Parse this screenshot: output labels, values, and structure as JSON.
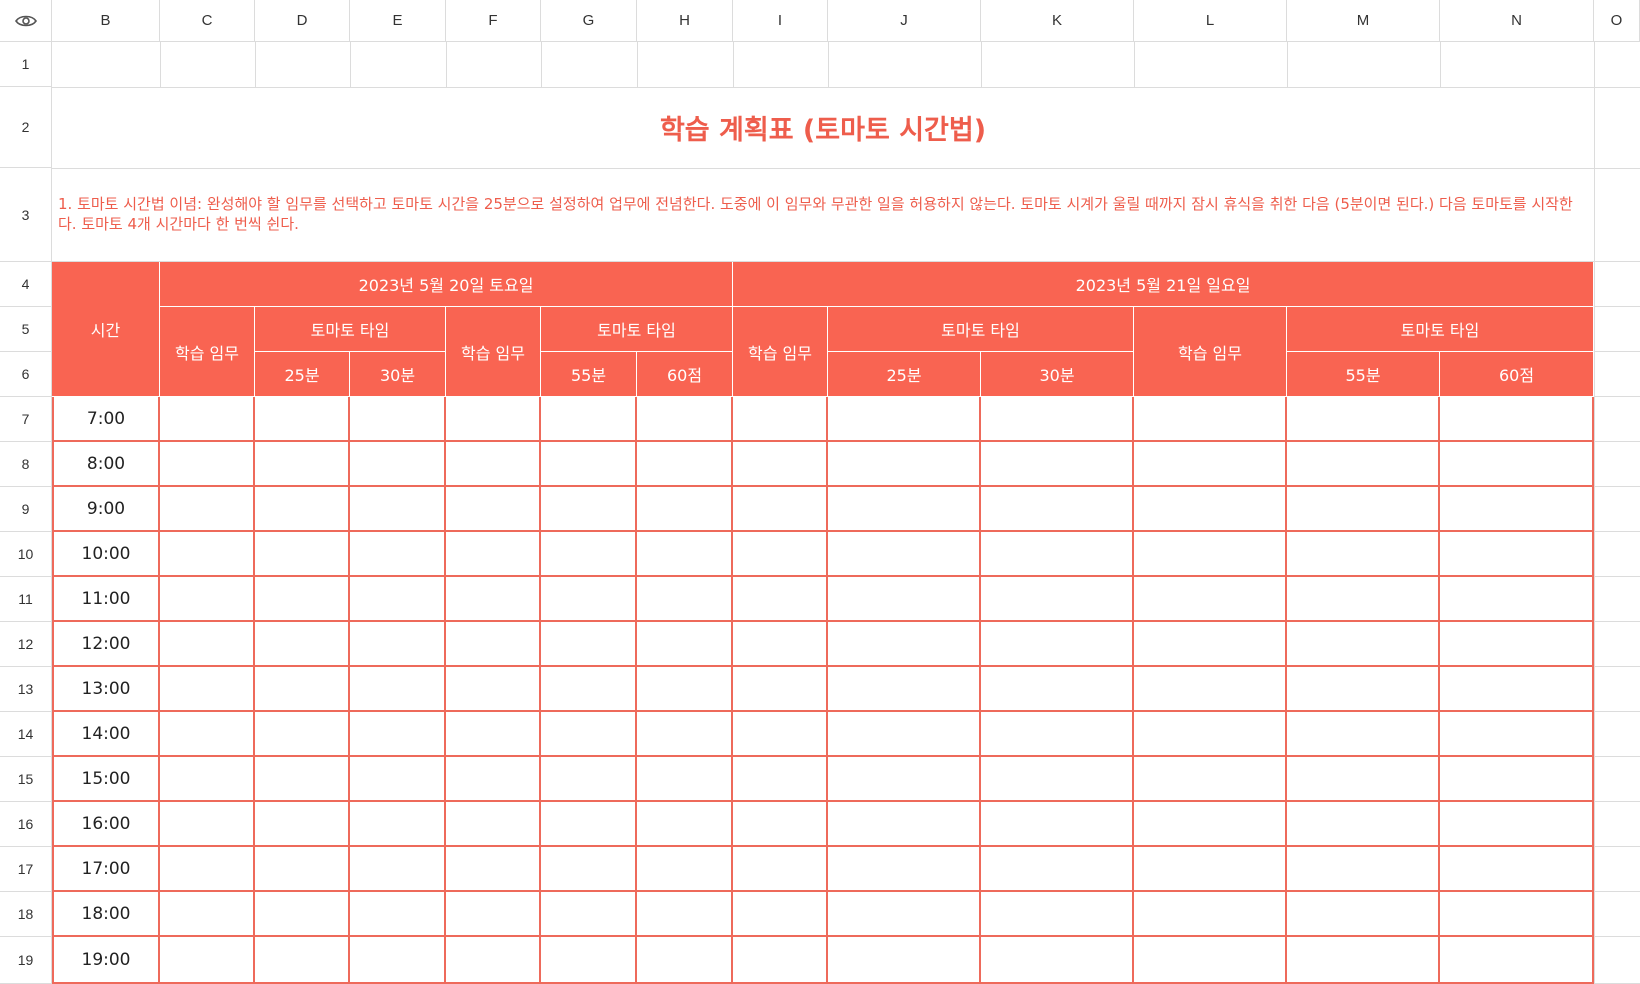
{
  "columns": [
    "B",
    "C",
    "D",
    "E",
    "F",
    "G",
    "H",
    "I",
    "J",
    "K",
    "L",
    "M",
    "N",
    "O"
  ],
  "rows": [
    "1",
    "2",
    "3",
    "4",
    "5",
    "6",
    "7",
    "8",
    "9",
    "10",
    "11",
    "12",
    "13",
    "14",
    "15",
    "16",
    "17",
    "18",
    "19"
  ],
  "title": "학습 계획표 (토마토 시간법)",
  "note": "1. 토마토 시간법 이념: 완성해야 할 임무를 선택하고 토마토 시간을 25분으로 설정하여 업무에 전념한다. 도중에 이 임무와 무관한 일을 허용하지 않는다. 토마토 시계가 울릴 때까지 잠시 휴식을 취한 다음 (5분이면 된다.) 다음 토마토를 시작한다. 토마토 4개 시간마다 한 번씩 쉰다.",
  "header": {
    "time_label": "시간",
    "day1": "2023년 5월 20일 토요일",
    "day2": "2023년 5월 21일 일요일",
    "task_label": "학습 임무",
    "tomato_label": "토마토 타임",
    "m25": "25분",
    "m30": "30분",
    "m55": "55분",
    "m60": "60점"
  },
  "times": [
    "7:00",
    "8:00",
    "9:00",
    "10:00",
    "11:00",
    "12:00",
    "13:00",
    "14:00",
    "15:00",
    "16:00",
    "17:00",
    "18:00",
    "19:00"
  ],
  "colors": {
    "accent": "#f96452",
    "accent_text": "#ee5d4c"
  },
  "icons": {
    "corner": "eye-icon"
  }
}
